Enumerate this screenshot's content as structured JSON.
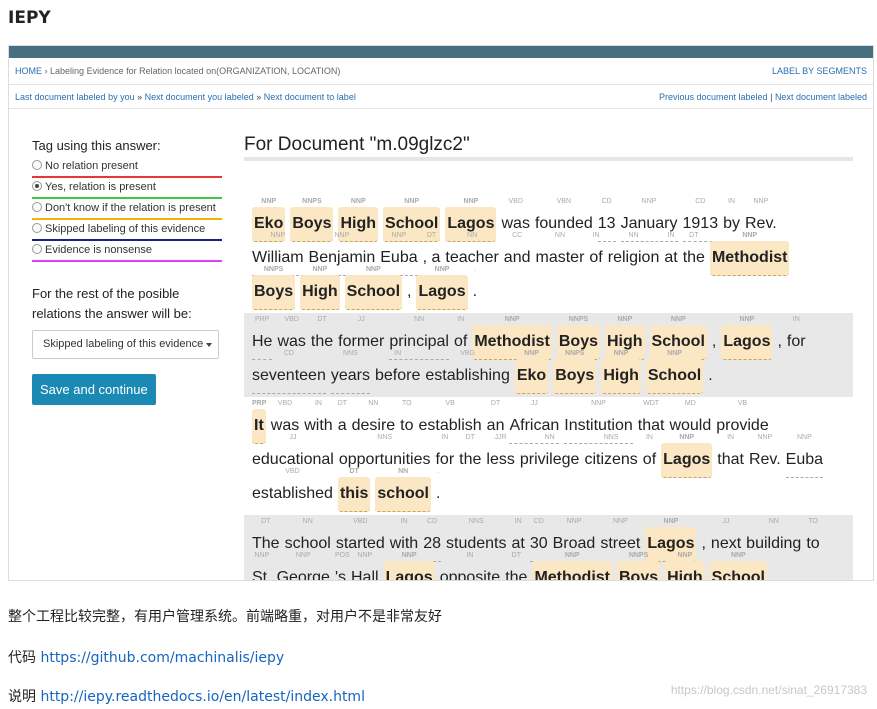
{
  "post": {
    "title": "IEPY",
    "desc": "整个工程比较完整，有用户管理系统。前端略重，对用户不是非常友好",
    "code_label": "代码",
    "code_link": "https://github.com/machinalis/iepy",
    "doc_label": "说明",
    "doc_link": "http://iepy.readthedocs.io/en/latest/index.html",
    "watermark": "https://blog.csdn.net/sinat_26917383"
  },
  "screenshot": {
    "breadcrumb_home": "HOME",
    "breadcrumb_sep": "›",
    "breadcrumb_text": "Labeling Evidence for Relation located on(ORGANIZATION, LOCATION)",
    "label_by_segments": "LABEL BY SEGMENTS",
    "nav_left": [
      "Last document labeled by you",
      "Next document you labeled",
      "Next document to label"
    ],
    "nav_seps": [
      "»",
      "»"
    ],
    "nav_right": [
      "Previous document labeled",
      "Next document labeled"
    ],
    "tag_heading": "Tag using this answer:",
    "options": [
      {
        "label": "No relation present",
        "selected": false,
        "color": "#e53935"
      },
      {
        "label": "Yes, relation is present",
        "selected": true,
        "color": "#43c443"
      },
      {
        "label": "Don't know if the relation is present",
        "selected": false,
        "color": "#f0b400"
      },
      {
        "label": "Skipped labeling of this evidence",
        "selected": false,
        "color": "#1a237e"
      },
      {
        "label": "Evidence is nonsense",
        "selected": false,
        "color": "#e040fb"
      }
    ],
    "rest_text": "For the rest of the posible relations the answer will be:",
    "select_value": "Skipped labeling of this evidence",
    "save_label": "Save and continue",
    "document_title": "For Document \"m.09glzc2\""
  },
  "segments": [
    {
      "shaded": false,
      "lines": [
        [
          [
            "NNP",
            "Eko",
            "e"
          ],
          [
            "NNPS",
            "Boys",
            "e"
          ],
          [
            "NNP",
            "High",
            "e"
          ],
          [
            "NNP",
            "School",
            "e"
          ],
          [
            "NNP",
            "Lagos",
            "e"
          ],
          [
            "VBD",
            "was",
            ""
          ],
          [
            "VBN",
            "founded",
            ""
          ],
          [
            "CD",
            "13",
            "t"
          ],
          [
            "NNP",
            "January",
            "t"
          ],
          [
            "CD",
            "1913",
            "t"
          ],
          [
            "IN",
            "by",
            ""
          ],
          [
            "NNP",
            "Rev.",
            ""
          ]
        ],
        [
          [
            "NNP",
            "William",
            "t"
          ],
          [
            "NNP",
            "Benjamin",
            "t"
          ],
          [
            "NNP",
            "Euba",
            "t"
          ],
          [
            "",
            "",
            ""
          ],
          [
            "DT",
            ", a",
            ""
          ],
          [
            "NN",
            "teacher",
            ""
          ],
          [
            "CC",
            "and",
            ""
          ],
          [
            "NN",
            "master",
            ""
          ],
          [
            "IN",
            "of",
            ""
          ],
          [
            "NN",
            "religion",
            ""
          ],
          [
            "IN",
            "at",
            ""
          ],
          [
            "DT",
            "the",
            ""
          ],
          [
            "NNP",
            "Methodist",
            "e"
          ]
        ],
        [
          [
            "NNPS",
            "Boys",
            "e"
          ],
          [
            "NNP",
            "High",
            "e"
          ],
          [
            "NNP",
            "School",
            "e"
          ],
          [
            "",
            ",",
            ""
          ],
          [
            "NNP",
            "Lagos",
            "e"
          ],
          [
            "",
            "",
            ""
          ],
          [
            ".",
            ".",
            ""
          ]
        ]
      ]
    },
    {
      "shaded": true,
      "lines": [
        [
          [
            "PRP",
            "He",
            "t"
          ],
          [
            "VBD",
            "was",
            ""
          ],
          [
            "DT",
            "the",
            ""
          ],
          [
            "JJ",
            "former",
            ""
          ],
          [
            "NN",
            "principal",
            "t"
          ],
          [
            "IN",
            "of",
            ""
          ],
          [
            "NNP",
            "Methodist",
            "e"
          ],
          [
            "NNPS",
            "Boys",
            "e"
          ],
          [
            "NNP",
            "High",
            "e"
          ],
          [
            "NNP",
            "School",
            "e"
          ],
          [
            "",
            ",",
            ""
          ],
          [
            "NNP",
            "Lagos",
            "e"
          ],
          [
            "",
            ",",
            ""
          ],
          [
            "IN",
            "for",
            ""
          ]
        ],
        [
          [
            "CD",
            "seventeen",
            "t"
          ],
          [
            "NNS",
            "years",
            "t"
          ],
          [
            "IN",
            "before",
            ""
          ],
          [
            "VBG",
            "establishing",
            ""
          ],
          [
            "NNP",
            "Eko",
            "e"
          ],
          [
            "NNPS",
            "Boys",
            "e"
          ],
          [
            "NNP",
            "High",
            "e"
          ],
          [
            "NNP",
            "School",
            "e"
          ],
          [
            ".",
            ".",
            ""
          ]
        ]
      ]
    },
    {
      "shaded": false,
      "lines": [
        [
          [
            "PRP",
            "It",
            "e"
          ],
          [
            "VBD",
            "was",
            ""
          ],
          [
            "IN",
            "with",
            ""
          ],
          [
            "DT",
            "a",
            ""
          ],
          [
            "NN",
            "desire",
            ""
          ],
          [
            "TO",
            "to",
            ""
          ],
          [
            "VB",
            "establish",
            ""
          ],
          [
            "DT",
            "an",
            ""
          ],
          [
            "JJ",
            "African",
            "t"
          ],
          [
            "NNP",
            "Institution",
            "t"
          ],
          [
            "WDT",
            "that",
            ""
          ],
          [
            "MD",
            "would",
            ""
          ],
          [
            "VB",
            "provide",
            ""
          ]
        ],
        [
          [
            "JJ",
            "educational",
            ""
          ],
          [
            "NNS",
            "opportunities",
            ""
          ],
          [
            "IN",
            "for",
            ""
          ],
          [
            "DT",
            "the",
            ""
          ],
          [
            "JJR",
            "less",
            ""
          ],
          [
            "NN",
            "privilege",
            ""
          ],
          [
            "NNS",
            "citizens",
            ""
          ],
          [
            "IN",
            "of",
            ""
          ],
          [
            "NNP",
            "Lagos",
            "e"
          ],
          [
            "IN",
            "that",
            ""
          ],
          [
            "NNP",
            "Rev.",
            ""
          ],
          [
            "NNP",
            "Euba",
            "t"
          ]
        ],
        [
          [
            "VBD",
            "established",
            ""
          ],
          [
            "DT",
            "this",
            "e"
          ],
          [
            "NN",
            "school",
            "e"
          ],
          [
            ".",
            ".",
            ""
          ]
        ]
      ]
    },
    {
      "shaded": true,
      "lines": [
        [
          [
            "DT",
            "The",
            ""
          ],
          [
            "NN",
            "school",
            ""
          ],
          [
            "VBD",
            "started",
            ""
          ],
          [
            "IN",
            "with",
            ""
          ],
          [
            "CD",
            "28",
            "t"
          ],
          [
            "NNS",
            "students",
            ""
          ],
          [
            "IN",
            "at",
            ""
          ],
          [
            "CD",
            "30",
            "t"
          ],
          [
            "NNP",
            "Broad",
            ""
          ],
          [
            "NNP",
            "street",
            ""
          ],
          [
            "NNP",
            "Lagos",
            "e"
          ],
          [
            "",
            ",",
            ""
          ],
          [
            "JJ",
            "next",
            ""
          ],
          [
            "NN",
            "building",
            ""
          ],
          [
            "TO",
            "to",
            ""
          ]
        ],
        [
          [
            "NNP",
            "St.",
            "t"
          ],
          [
            "NNP",
            "George",
            "t"
          ],
          [
            "POS",
            "'s",
            ""
          ],
          [
            "NNP",
            "Hall",
            ""
          ],
          [
            "",
            "",
            ""
          ],
          [
            "NNP",
            "Lagos",
            "e"
          ],
          [
            "",
            "",
            ""
          ],
          [
            "IN",
            "opposite",
            ""
          ],
          [
            "DT",
            "the",
            ""
          ],
          [
            "NNP",
            "Methodist",
            "e"
          ],
          [
            "NNPS",
            "Boys",
            "e"
          ],
          [
            "NNP",
            "High",
            "e"
          ],
          [
            "NNP",
            "School",
            "e"
          ]
        ]
      ]
    }
  ]
}
